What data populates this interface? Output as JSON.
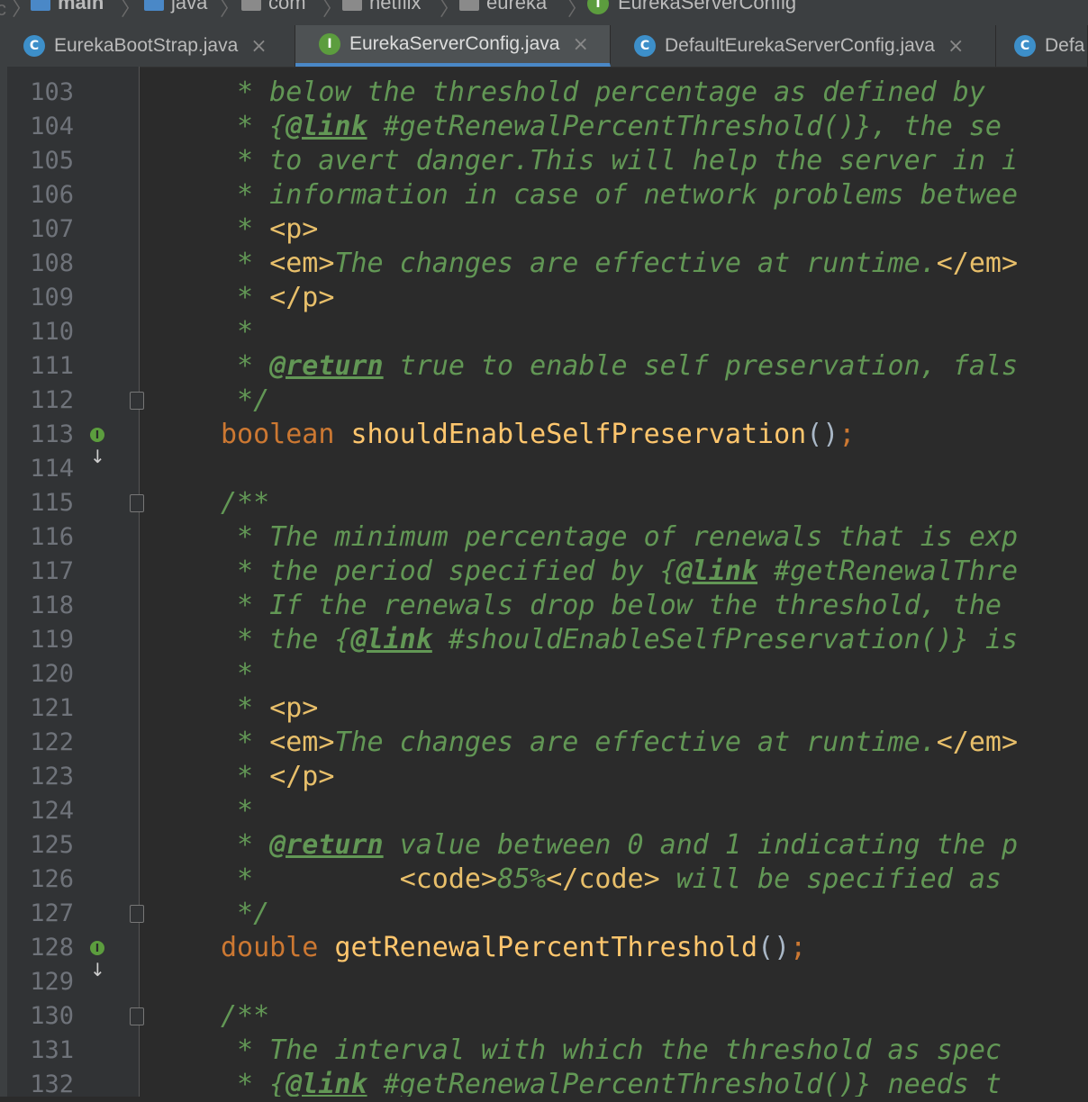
{
  "breadcrumb": {
    "items": [
      "main",
      "java",
      "com",
      "netflix",
      "eureka",
      "EurekaServerConfig"
    ]
  },
  "tabs": [
    {
      "label": "EurekaBootStrap.java",
      "icon": "C",
      "active": false
    },
    {
      "label": "EurekaServerConfig.java",
      "icon": "I",
      "active": true
    },
    {
      "label": "DefaultEurekaServerConfig.java",
      "icon": "C",
      "active": false
    },
    {
      "label": "Defa",
      "icon": "C",
      "active": false
    }
  ],
  "colors": {
    "accent": "#4a88c7",
    "doc": "#629755",
    "keyword": "#cc7832",
    "method": "#ffc66d"
  },
  "lines": [
    {
      "n": "103",
      "t": " * below the threshold percentage as defined by"
    },
    {
      "n": "104",
      "t": " * {@link #getRenewalPercentThreshold()}, the se"
    },
    {
      "n": "105",
      "t": " * to avert danger.This will help the server in i"
    },
    {
      "n": "106",
      "t": " * information in case of network problems betwee"
    },
    {
      "n": "107",
      "t": " * <p>"
    },
    {
      "n": "108",
      "t": " * <em>The changes are effective at runtime.</em>"
    },
    {
      "n": "109",
      "t": " * </p>"
    },
    {
      "n": "110",
      "t": " *"
    },
    {
      "n": "111",
      "t": " * @return true to enable self preservation, fals"
    },
    {
      "n": "112",
      "t": " */"
    },
    {
      "n": "113",
      "t": "boolean shouldEnableSelfPreservation();"
    },
    {
      "n": "114",
      "t": ""
    },
    {
      "n": "115",
      "t": "/**"
    },
    {
      "n": "116",
      "t": " * The minimum percentage of renewals that is exp"
    },
    {
      "n": "117",
      "t": " * the period specified by {@link #getRenewalThre"
    },
    {
      "n": "118",
      "t": " * If the renewals drop below the threshold, the"
    },
    {
      "n": "119",
      "t": " * the {@link #shouldEnableSelfPreservation()} is"
    },
    {
      "n": "120",
      "t": " *"
    },
    {
      "n": "121",
      "t": " * <p>"
    },
    {
      "n": "122",
      "t": " * <em>The changes are effective at runtime.</em>"
    },
    {
      "n": "123",
      "t": " * </p>"
    },
    {
      "n": "124",
      "t": " *"
    },
    {
      "n": "125",
      "t": " * @return value between 0 and 1 indicating the p"
    },
    {
      "n": "126",
      "t": " *         <code>85%</code> will be specified as"
    },
    {
      "n": "127",
      "t": " */"
    },
    {
      "n": "128",
      "t": "double getRenewalPercentThreshold();"
    },
    {
      "n": "129",
      "t": ""
    },
    {
      "n": "130",
      "t": "/**"
    },
    {
      "n": "131",
      "t": " * The interval with which the threshold as spec"
    },
    {
      "n": "132",
      "t": " * {@link #getRenewalPercentThreshold()} needs t"
    }
  ]
}
